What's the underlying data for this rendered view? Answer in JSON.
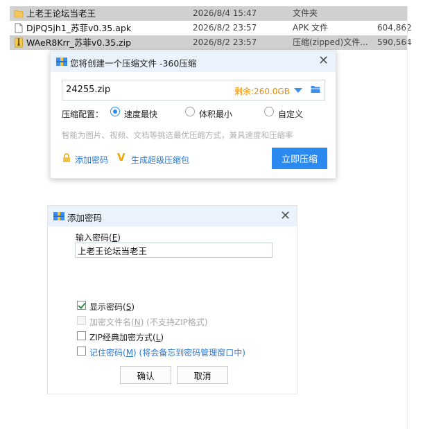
{
  "files": [
    {
      "name": "上老王论坛当老王",
      "date": "2026/8/4 15:47",
      "type": "文件夹",
      "size": "",
      "icon": "folder-icon",
      "selected": true
    },
    {
      "name": "DjPQ5jh1_苏菲v0.35.apk",
      "date": "2026/8/2 23:57",
      "type": "APK 文件",
      "size": "604,862",
      "icon": "apk-file-icon",
      "selected": false
    },
    {
      "name": "WAeR8Krr_苏菲v0.35.zip",
      "date": "2026/8/2 23:57",
      "type": "压缩(zipped)文件...",
      "size": "590,564",
      "icon": "zip-file-icon",
      "selected": true
    }
  ],
  "compress_dialog": {
    "title": "您将创建一个压缩文件 -360压缩",
    "filename": "24255.zip",
    "free_space": "剩余:260.0GB",
    "config_label": "压缩配置：",
    "options": [
      "速度最快",
      "体积最小",
      "自定义"
    ],
    "selected_option": "速度最快",
    "hint": "智能为图片、视频、文档等挑选最优压缩方式，兼具速度和压缩率",
    "add_password": "添加密码",
    "super_package": "生成超级压缩包",
    "compress_button": "立即压缩",
    "colors": {
      "accent": "#2a8af0",
      "link": "#2a78d4",
      "warning": "#f08c00"
    }
  },
  "password_dialog": {
    "title": "添加密码",
    "input_label": "输入密码(",
    "input_label_key": "E",
    "input_label_end": ")",
    "password_value": "上老王论坛当老王",
    "show_password": {
      "label": "显示密码(",
      "key": "S",
      "end": ")",
      "checked": true
    },
    "encrypt_filenames": {
      "label": "加密文件名(",
      "key": "N",
      "end": ") (不支持ZIP格式)",
      "checked": false,
      "disabled": true
    },
    "zip_classic": {
      "label": "ZIP经典加密方式(",
      "key": "L",
      "end": ")",
      "checked": false
    },
    "remember_password": {
      "label": "记住密码(",
      "key": "M",
      "end": ") (将会备忘到密码管理窗口中)",
      "checked": false
    },
    "ok_button": "确认",
    "cancel_button": "取消"
  }
}
